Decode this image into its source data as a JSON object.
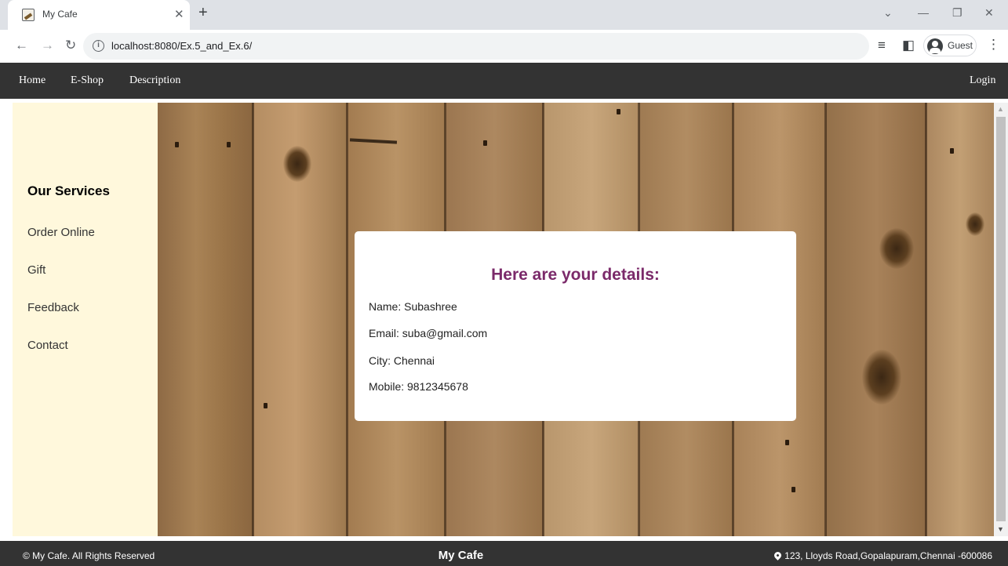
{
  "browser": {
    "tab_title": "My Cafe",
    "url": "localhost:8080/Ex.5_and_Ex.6/",
    "profile_label": "Guest"
  },
  "navbar": {
    "links": [
      "Home",
      "E-Shop",
      "Description"
    ],
    "login_label": "Login"
  },
  "sidebar": {
    "heading": "Our Services",
    "links": [
      "Order Online",
      "Gift",
      "Feedback",
      "Contact"
    ]
  },
  "details_card": {
    "title": "Here are your details:",
    "name": "Name: Subashree",
    "email": "Email: suba@gmail.com",
    "city": "City: Chennai",
    "mobile": "Mobile: 9812345678"
  },
  "footer": {
    "copyright": "© My Cafe. All Rights Reserved",
    "brand": "My Cafe",
    "address": "123, Lloyds Road,Gopalapuram,Chennai -600086"
  },
  "colors": {
    "navbar_bg": "#333333",
    "sidebar_bg": "#fff8dc",
    "card_title": "#7b2a6a",
    "wood": "#a47c53"
  }
}
